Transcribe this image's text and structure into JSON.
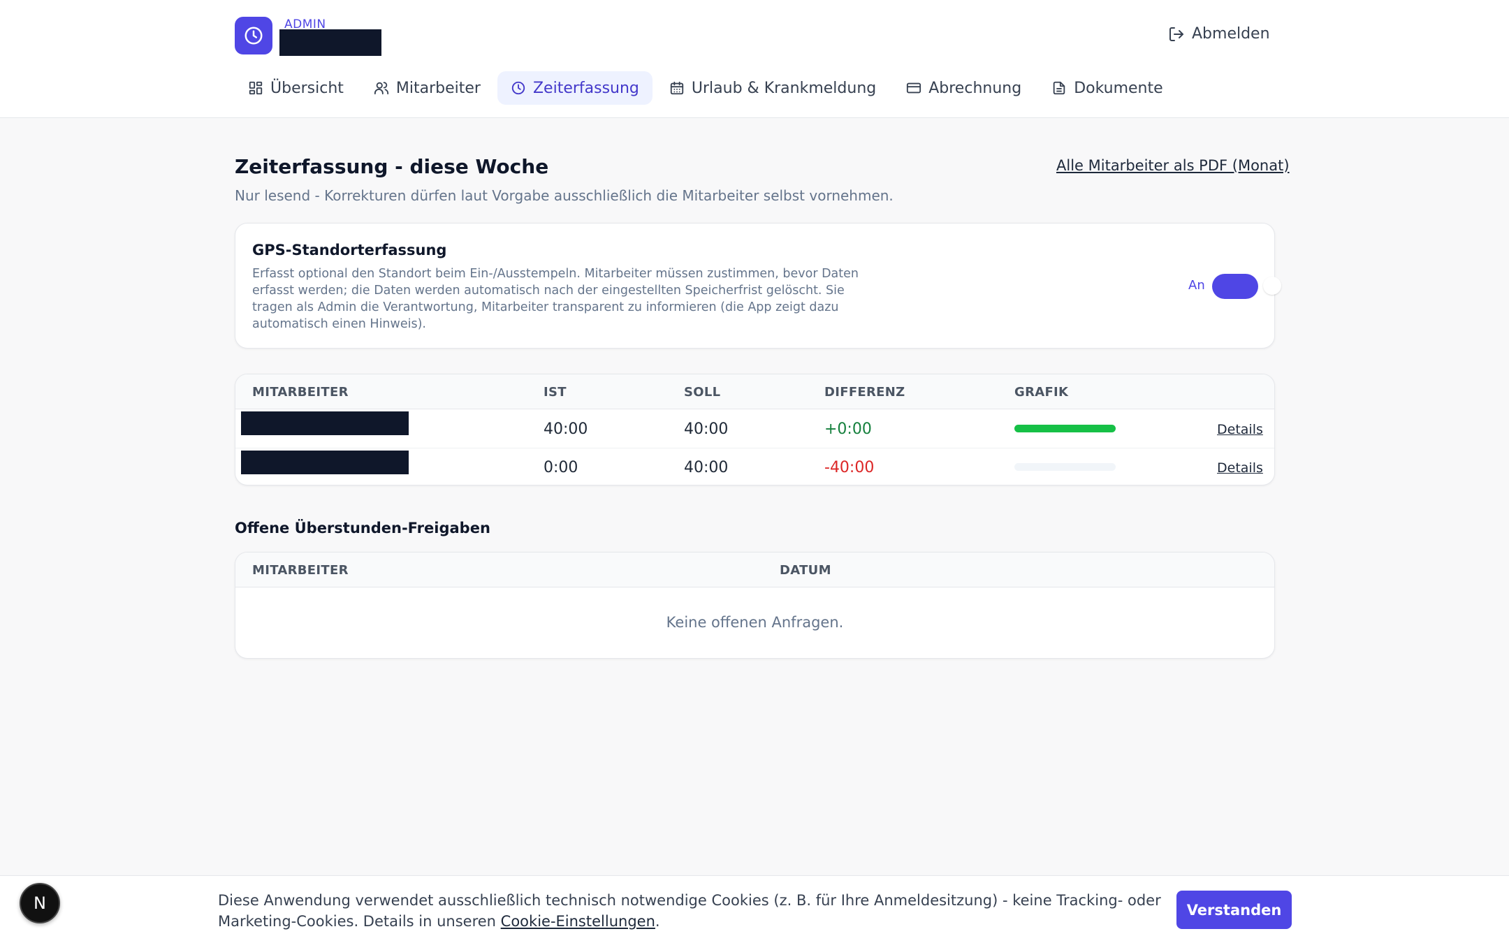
{
  "header": {
    "role": "ADMIN",
    "logout_label": "Abmelden",
    "tabs": [
      {
        "label": "Übersicht",
        "icon": "grid-icon"
      },
      {
        "label": "Mitarbeiter",
        "icon": "users-icon"
      },
      {
        "label": "Zeiterfassung",
        "icon": "clock-icon",
        "active": true
      },
      {
        "label": "Urlaub & Krankmeldung",
        "icon": "calendar-icon"
      },
      {
        "label": "Abrechnung",
        "icon": "credit-card-icon"
      },
      {
        "label": "Dokumente",
        "icon": "document-icon"
      }
    ]
  },
  "main": {
    "title": "Zeiterfassung - diese Woche",
    "subtitle": "Nur lesend - Korrekturen dürfen laut Vorgabe ausschließlich die Mitarbeiter selbst vornehmen.",
    "pdf_link": "Alle Mitarbeiter als PDF (Monat)",
    "gps": {
      "title": "GPS-Standorterfassung",
      "description": "Erfasst optional den Standort beim Ein-/Ausstempeln. Mitarbeiter müssen zustimmen, bevor Daten erfasst werden; die Daten werden automatisch nach der eingestellten Speicherfrist gelöscht. Sie tragen als Admin die Verantwortung, Mitarbeiter transparent zu informieren (die App zeigt dazu automatisch einen Hinweis).",
      "toggle_label": "An",
      "enabled": true
    },
    "time_table": {
      "columns": [
        "MITARBEITER",
        "IST",
        "SOLL",
        "DIFFERENZ",
        "GRAFIK"
      ],
      "rows": [
        {
          "ist": "40:00",
          "soll": "40:00",
          "differenz": "+0:00",
          "progress": 1.0,
          "details": "Details"
        },
        {
          "ist": "0:00",
          "soll": "40:00",
          "differenz": "-40:00",
          "progress": 0.0,
          "details": "Details"
        }
      ]
    },
    "pending": {
      "title": "Offene Überstunden-Freigaben",
      "columns": [
        "MITARBEITER",
        "DATUM"
      ],
      "empty_text": "Keine offenen Anfragen."
    }
  },
  "cookie": {
    "text": "Diese Anwendung verwendet ausschließlich technisch notwendige Cookies (z. B. für Ihre Anmeldesitzung) - keine Tracking- oder Marketing-Cookies. Details in unseren ",
    "link": "Cookie-Einstellungen",
    "suffix": ".",
    "button": "Verstanden"
  },
  "next_badge": "N",
  "colors": {
    "accent": "#4f46e5",
    "positive": "#15803d",
    "negative": "#dc2626",
    "bar": "#16c046"
  }
}
